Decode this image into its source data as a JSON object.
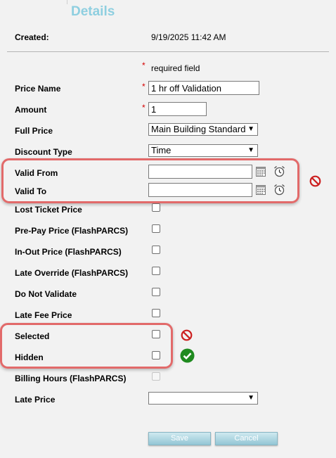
{
  "header": {
    "title": "Details"
  },
  "created": {
    "label": "Created:",
    "value": "9/19/2025 11:42 AM"
  },
  "required_note": {
    "star": "*",
    "text": "required field"
  },
  "fields": {
    "price_name": {
      "label": "Price Name",
      "value": "1 hr off Validation"
    },
    "amount": {
      "label": "Amount",
      "value": "1"
    },
    "full_price": {
      "label": "Full Price",
      "value": "Main Building Standard"
    },
    "discount_type": {
      "label": "Discount Type",
      "value": "Time"
    },
    "valid_from": {
      "label": "Valid From",
      "value": ""
    },
    "valid_to": {
      "label": "Valid To",
      "value": ""
    },
    "lost_ticket": {
      "label": "Lost Ticket Price",
      "checked": false
    },
    "prepay": {
      "label": "Pre-Pay Price (FlashPARCS)",
      "checked": false
    },
    "in_out": {
      "label": "In-Out Price (FlashPARCS)",
      "checked": false
    },
    "late_override": {
      "label": "Late Override (FlashPARCS)",
      "checked": false
    },
    "do_not_validate": {
      "label": "Do Not Validate",
      "checked": false
    },
    "late_fee": {
      "label": "Late Fee Price",
      "checked": false
    },
    "selected": {
      "label": "Selected",
      "checked": false
    },
    "hidden": {
      "label": "Hidden",
      "checked": false
    },
    "billing_hours": {
      "label": "Billing Hours (FlashPARCS)",
      "checked": false,
      "disabled": true
    },
    "late_price": {
      "label": "Late Price",
      "value": ""
    }
  },
  "buttons": {
    "save": "Save",
    "cancel": "Cancel"
  },
  "icons": {
    "calendar": "calendar-icon",
    "clock": "alarm-clock-icon",
    "invalid": "prohibited-icon",
    "valid": "check-circle-icon"
  },
  "colors": {
    "title": "#8ecfe0",
    "required_star": "#d40000",
    "highlight": "#e26a6a",
    "prohibited": "#cc1f1f",
    "valid": "#1f8a1f",
    "button": "#93c6d5"
  }
}
